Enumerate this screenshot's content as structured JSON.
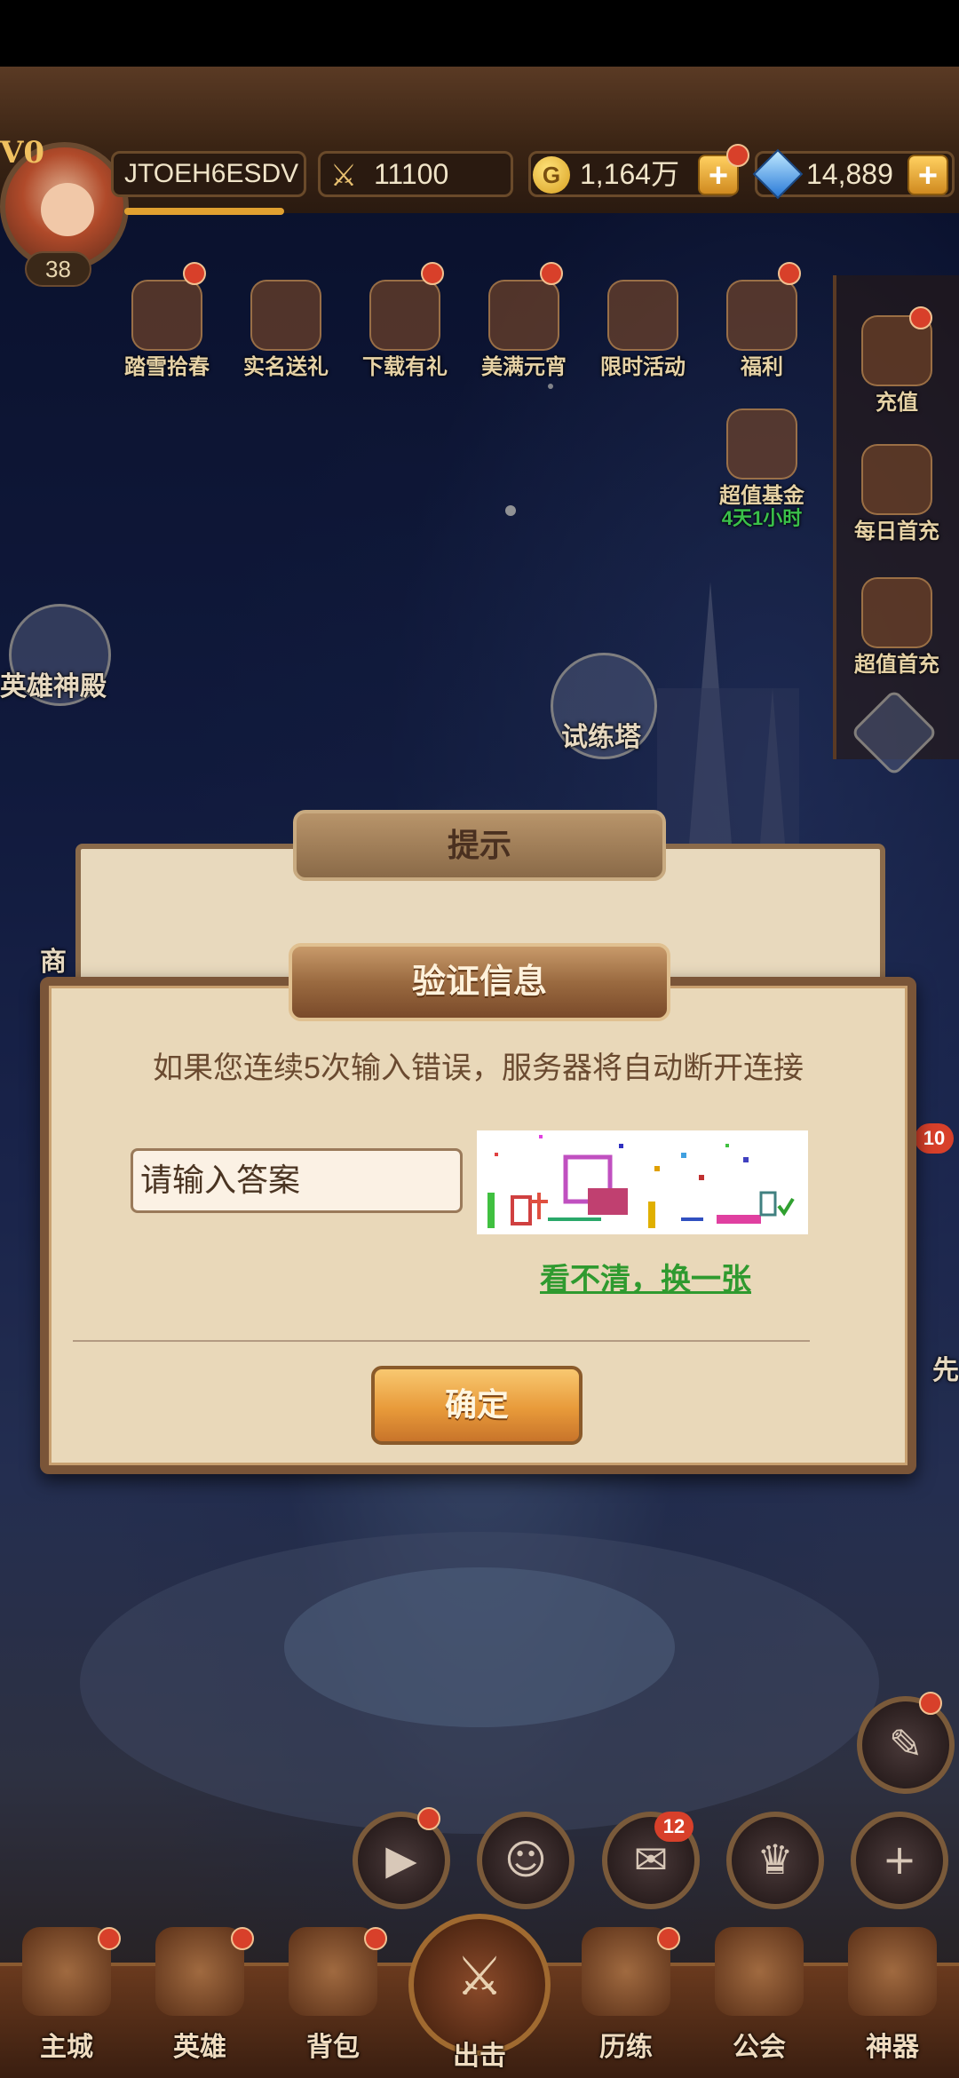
{
  "header": {
    "vip": "V0",
    "level": "38",
    "player_name": "JTOEH6ESDV",
    "power": "11100",
    "gold": "1,164万",
    "gems": "14,889",
    "gold_icon_letter": "G"
  },
  "activities": [
    {
      "label": "踏雪拾春",
      "icon": "flower-icon"
    },
    {
      "label": "实名送礼",
      "icon": "id-card-icon"
    },
    {
      "label": "下载有礼",
      "icon": "download-icon"
    },
    {
      "label": "美满元宵",
      "icon": "lantern-icon"
    },
    {
      "label": "限时活动",
      "icon": "banner-icon"
    },
    {
      "label": "福利",
      "icon": "gift-icon"
    }
  ],
  "fund": {
    "label": "超值基金",
    "timer": "4天1小时"
  },
  "side_menu": [
    {
      "label": "充值",
      "icon": "diamond-icon"
    },
    {
      "label": "每日首充",
      "icon": "treasure-icon"
    },
    {
      "label": "超值首充",
      "icon": "hero-portrait-icon"
    }
  ],
  "map": {
    "hero_temple": "英雄神殿",
    "trial_tower": "试练塔",
    "shop_partial": "商",
    "right_partial": "先"
  },
  "back_dialog": {
    "title": "提示"
  },
  "dialog": {
    "title": "验证信息",
    "warning": "如果您连续5次输入错误，服务器将自动断开连接",
    "input_placeholder": "请输入答案",
    "refresh_link": "看不清，换一张",
    "confirm": "确定"
  },
  "right_badge": "10",
  "mail_badge": "12",
  "bottom_nav": [
    {
      "label": "主城",
      "icon": "castle-icon"
    },
    {
      "label": "英雄",
      "icon": "hero-icon"
    },
    {
      "label": "背包",
      "icon": "bag-icon"
    },
    {
      "label": "出击",
      "icon": "crossed-swords-icon"
    },
    {
      "label": "历练",
      "icon": "training-icon"
    },
    {
      "label": "公会",
      "icon": "guild-icon"
    },
    {
      "label": "神器",
      "icon": "artifact-icon"
    }
  ],
  "colors": {
    "accent_green": "#2f9a2f",
    "dialog_bg": "#e9d8b9",
    "button_orange": "#e89a3a",
    "notice_red": "#d8402a"
  }
}
